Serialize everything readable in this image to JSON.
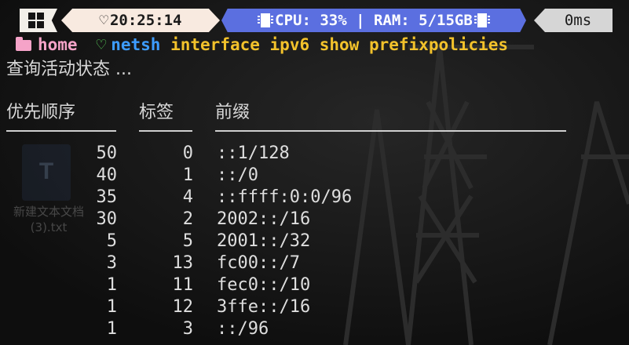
{
  "colors": {
    "time_bg": "#f8eae0",
    "sys_bg": "#5b6fe0",
    "home": "#f5a3c8",
    "heart": "#5cd65c",
    "command": "#3d9cff",
    "args": "#f3c22b"
  },
  "bar": {
    "time": "20:25:14",
    "sys": "CPU: 33% | RAM: 5/15GB",
    "duration": "0ms"
  },
  "command": {
    "dir": "home",
    "name": "netsh",
    "args": "interface ipv6 show prefixpolicies"
  },
  "status": "查询活动状态 ...",
  "table": {
    "headers": [
      "优先顺序",
      "标签",
      "前缀"
    ],
    "rows": [
      {
        "precedence": "50",
        "label": "0",
        "prefix": "::1/128"
      },
      {
        "precedence": "40",
        "label": "1",
        "prefix": "::/0"
      },
      {
        "precedence": "35",
        "label": "4",
        "prefix": "::ffff:0:0/96"
      },
      {
        "precedence": "30",
        "label": "2",
        "prefix": "2002::/16"
      },
      {
        "precedence": "5",
        "label": "5",
        "prefix": "2001::/32"
      },
      {
        "precedence": "3",
        "label": "13",
        "prefix": "fc00::/7"
      },
      {
        "precedence": "1",
        "label": "11",
        "prefix": "fec0::/10"
      },
      {
        "precedence": "1",
        "label": "12",
        "prefix": "3ffe::/16"
      },
      {
        "precedence": "1",
        "label": "3",
        "prefix": "::/96"
      }
    ]
  },
  "desktop_icon": {
    "glyph": "T",
    "caption": "新建文本文档 (3).txt"
  }
}
